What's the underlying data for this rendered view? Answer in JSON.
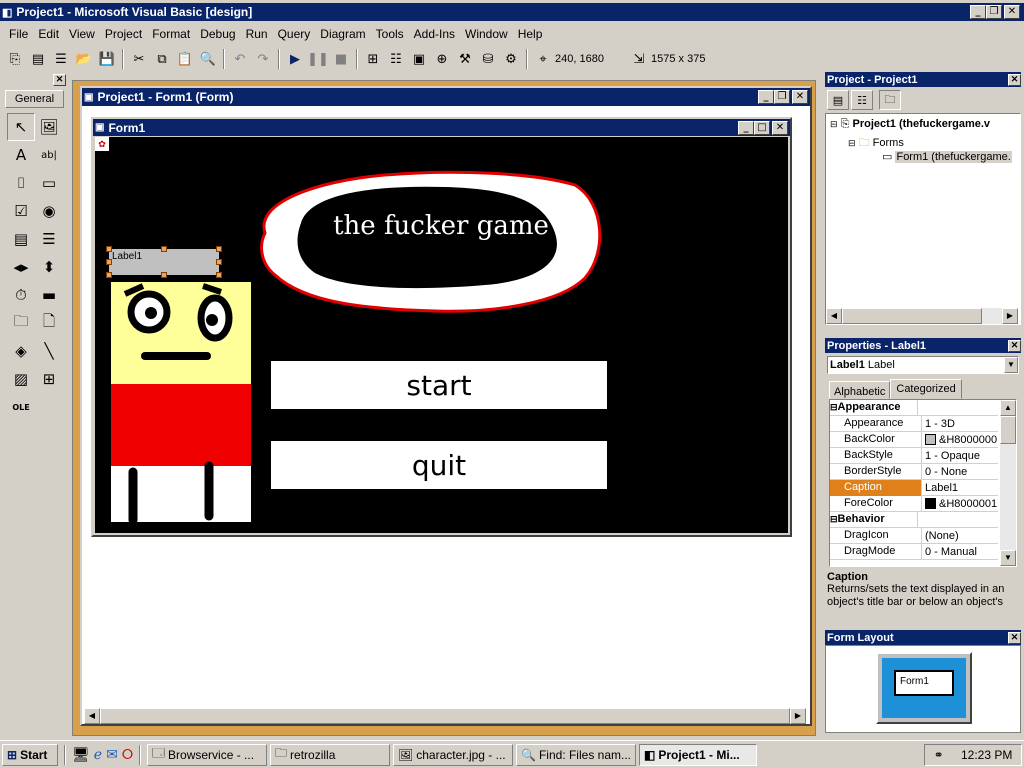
{
  "app": {
    "title": "Project1 - Microsoft Visual Basic [design]"
  },
  "menu": [
    "File",
    "Edit",
    "View",
    "Project",
    "Format",
    "Debug",
    "Run",
    "Query",
    "Diagram",
    "Tools",
    "Add-Ins",
    "Window",
    "Help"
  ],
  "toolbar": {
    "position_readout": "240, 1680",
    "size_readout": "1575 x 375"
  },
  "toolbox": {
    "tab_label": "General",
    "tools": [
      "pointer-icon",
      "picturebox-icon",
      "label-icon",
      "textbox-icon",
      "frame-icon",
      "commandbutton-icon",
      "checkbox-icon",
      "optionbutton-icon",
      "combobox-icon",
      "listbox-icon",
      "hscrollbar-icon",
      "vscrollbar-icon",
      "timer-icon",
      "drivelistbox-icon",
      "dirlistbox-icon",
      "filelistbox-icon",
      "shape-icon",
      "line-icon",
      "image-icon",
      "data-icon",
      "ole-icon"
    ]
  },
  "designer": {
    "window_title": "Project1 - Form1 (Form)",
    "form_title": "Form1",
    "label_caption": "Label1",
    "blob_text": "the fucker game",
    "start_button": "start",
    "quit_button": "quit"
  },
  "project_explorer": {
    "title": "Project - Project1",
    "project_node": "Project1 (thefuckergame.v",
    "forms_node": "Forms",
    "form_node": "Form1 (thefuckergame."
  },
  "properties": {
    "title": "Properties - Label1",
    "object_name": "Label1",
    "object_type": "Label",
    "tab_alphabetic": "Alphabetic",
    "tab_categorized": "Categorized",
    "rows": [
      {
        "type": "category",
        "name": "Appearance"
      },
      {
        "name": "Appearance",
        "value": "1 - 3D"
      },
      {
        "name": "BackColor",
        "value": "&H8000000",
        "swatch": "#c0c0c0"
      },
      {
        "name": "BackStyle",
        "value": "1 - Opaque"
      },
      {
        "name": "BorderStyle",
        "value": "0 - None"
      },
      {
        "name": "Caption",
        "value": "Label1",
        "selected": true
      },
      {
        "name": "ForeColor",
        "value": "&H8000001",
        "swatch": "#000000"
      },
      {
        "type": "category",
        "name": "Behavior"
      },
      {
        "name": "DragIcon",
        "value": "(None)"
      },
      {
        "name": "DragMode",
        "value": "0 - Manual"
      }
    ],
    "desc_title": "Caption",
    "desc_text": "Returns/sets the text displayed in an object's title bar or below an object's"
  },
  "form_layout": {
    "title": "Form Layout",
    "preview_label": "Form1"
  },
  "taskbar": {
    "start": "Start",
    "tasks": [
      "Browservice - ...",
      "retrozilla",
      "character.jpg - ...",
      "Find: Files nam...",
      "Project1 - Mi..."
    ],
    "clock": "12:23 PM"
  },
  "colors": {
    "titlebar": "#0a246a",
    "face": "#d4d0c8",
    "mdi_border": "#d9a04c",
    "selected_prop": "#e0801a",
    "form_bg": "#000000"
  }
}
